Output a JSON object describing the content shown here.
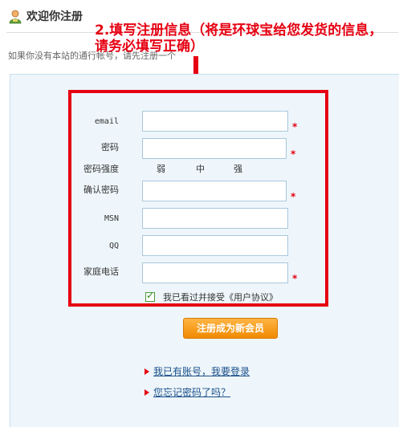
{
  "header": {
    "title": "欢迎你注册",
    "subtitle": "如果你没有本站的通行帐号，请先注册一个"
  },
  "annotation": {
    "note": "2.填写注册信息（将是环球宝给您发货的信息，请务必填写正确）"
  },
  "form": {
    "email_label": "email",
    "password_label": "密码",
    "strength_label": "密码强度",
    "strength_levels": [
      "弱",
      "中",
      "强"
    ],
    "confirm_label": "确认密码",
    "msn_label": "MSN",
    "qq_label": "QQ",
    "phone_label": "家庭电话",
    "required_mark": "*",
    "agree_text": "我已看过并接受",
    "agree_link": "《用户协议》",
    "agree_checked": true,
    "submit_label": "注册成为新会员"
  },
  "links": {
    "login": "我已有账号，我要登录",
    "forgot": "您忘记密码了吗？"
  },
  "colors": {
    "accent_red": "#e60012",
    "submit_orange": "#f08a00",
    "link_blue": "#1a4f8a",
    "panel_bg": "#eef6fb"
  },
  "icons": {
    "header_icon": "user-icon",
    "arrow": "arrow-down-icon",
    "bullet": "triangle-bullet-icon"
  }
}
